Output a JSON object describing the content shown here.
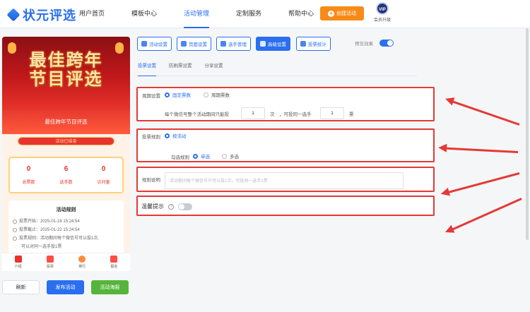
{
  "brand": {
    "name": "状元评选"
  },
  "nav": [
    {
      "label": "用户首页",
      "active": false
    },
    {
      "label": "模板中心",
      "active": false
    },
    {
      "label": "活动管理",
      "active": true
    },
    {
      "label": "定制服务",
      "active": false
    },
    {
      "label": "帮助中心",
      "active": false
    }
  ],
  "header": {
    "create_label": "创建活动",
    "vip_badge": "VIP",
    "vip_label": "会员升级"
  },
  "preview": {
    "banner_title_1": "最佳跨年",
    "banner_title_2": "节目评选",
    "card_title": "最佳跨年节目评选",
    "status": "活动已结束",
    "stats": [
      {
        "value": "0",
        "label": "总票数"
      },
      {
        "value": "6",
        "label": "选手数"
      },
      {
        "value": "0",
        "label": "访问量"
      }
    ],
    "rules_title": "活动规则",
    "rule_start": "投票开始：2025-01-16 15:24:54",
    "rule_end": "投票截止：2025-01-22 15:24:54",
    "rule_vote": "投票规则：活动期间每个微信号可以投1次,",
    "rule_vote_2": "可以对同一选手投1票",
    "tabs": [
      "介绍",
      "投票",
      "排行",
      "报名"
    ]
  },
  "actions": {
    "refresh": "刷新",
    "publish": "发布活动",
    "poster": "活动海报"
  },
  "settings_tabs": [
    {
      "label": "活动设置",
      "active": false
    },
    {
      "label": "页面设置",
      "active": false
    },
    {
      "label": "选手管理",
      "active": false
    },
    {
      "label": "高级设置",
      "active": true
    },
    {
      "label": "投票统计",
      "active": false
    }
  ],
  "preview_toggle": {
    "label": "预览效果",
    "on": true
  },
  "subtabs": [
    {
      "label": "投票设置",
      "active": true
    },
    {
      "label": "防刷票设置",
      "active": false
    },
    {
      "label": "分享设置",
      "active": false
    }
  ],
  "period": {
    "label": "周期设置",
    "opt_fixed": "固定票数",
    "opt_cycle": "周期票数",
    "selected": "固定票数",
    "desc_prefix": "每个微信号整个活动期间只能投",
    "times_value": "1",
    "times_unit": "次",
    "desc_mid": "，可投同一选手",
    "votes_value": "1",
    "votes_unit": "票"
  },
  "vote_rule": {
    "label": "投票规则",
    "opt": "按活动",
    "check_label": "勾选规则",
    "opt_single": "单选",
    "opt_multi": "多选",
    "selected": "单选"
  },
  "rule_desc": {
    "label": "规则说明",
    "placeholder": "活动期间每个微信号只可以投1次，可投同一选手1票"
  },
  "fav_tip": {
    "label": "温馨提示",
    "help": "?",
    "on": false
  },
  "colors": {
    "primary": "#2a6ff0",
    "accent": "#f88b17",
    "highlight": "#e53935"
  }
}
